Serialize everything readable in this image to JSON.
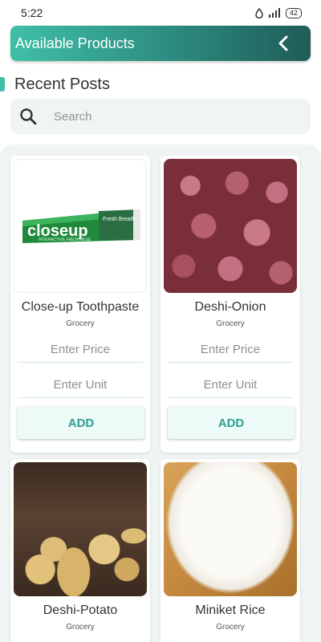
{
  "status_bar": {
    "time": "5:22",
    "battery": "42"
  },
  "app_bar": {
    "title": "Available Products"
  },
  "section": {
    "title": "Recent Posts"
  },
  "search": {
    "placeholder": "Search",
    "value": ""
  },
  "products": [
    {
      "name": "Close-up Toothpaste",
      "category": "Grocery",
      "price_placeholder": "Enter Price",
      "unit_placeholder": "Enter Unit",
      "add_label": "ADD",
      "image_brand": "closeup",
      "image_tag": "Fresh Breath",
      "image_sub": "INTERACTIVE FRESHNESS"
    },
    {
      "name": "Deshi-Onion",
      "category": "Grocery",
      "price_placeholder": "Enter Price",
      "unit_placeholder": "Enter Unit",
      "add_label": "ADD"
    },
    {
      "name": "Deshi-Potato",
      "category": "Grocery"
    },
    {
      "name": "Miniket Rice",
      "category": "Grocery"
    }
  ],
  "colors": {
    "accent": "#3fbfa7",
    "app_bar_dark": "#1f5c58",
    "add_text": "#2f9e90",
    "add_bg": "#ecfbf8",
    "panel_bg": "#f0f5f4"
  }
}
